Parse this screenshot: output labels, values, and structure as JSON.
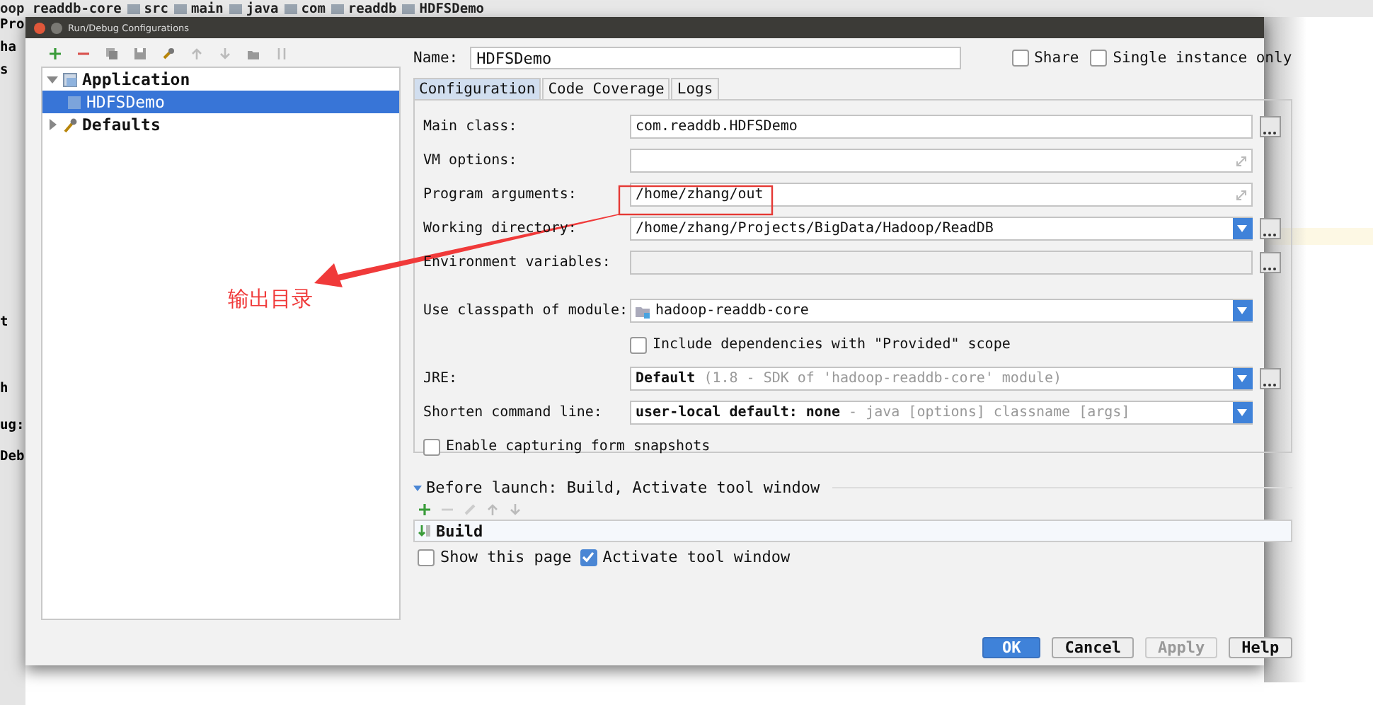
{
  "background_ide": {
    "breadcrumbs": [
      "oop readdb-core",
      "src",
      "main",
      "java",
      "com",
      "readdb",
      "HDFSDemo"
    ],
    "side_fragments": [
      "Pro",
      "ha",
      "s",
      "t",
      "h",
      "ug:",
      "Deb"
    ]
  },
  "dialog": {
    "title": "Run/Debug Configurations",
    "tree": [
      {
        "label": "Application",
        "expanded": true,
        "selected": false,
        "children": [
          {
            "label": "HDFSDemo",
            "selected": true
          }
        ]
      },
      {
        "label": "Defaults",
        "expanded": false,
        "selected": false
      }
    ],
    "name": {
      "label": "Name:",
      "value": "HDFSDemo"
    },
    "options": [
      {
        "label": "Share",
        "checked": false
      },
      {
        "label": "Single instance only",
        "checked": false
      }
    ],
    "tabs": [
      {
        "label": "Configuration",
        "selected": true
      },
      {
        "label": "Code Coverage",
        "selected": false
      },
      {
        "label": "Logs",
        "selected": false
      }
    ],
    "fields": [
      {
        "kind": "browse",
        "label": "Main class:",
        "value": "com.readdb.HDFSDemo"
      },
      {
        "kind": "expand",
        "label": "VM options:"
      },
      {
        "kind": "expand",
        "label": "Program arguments:",
        "value": "/home/zhang/out"
      },
      {
        "kind": "dropdown_browse",
        "label": "Working directory:",
        "value": "/home/zhang/Projects/BigData/Hadoop/ReadDB"
      },
      {
        "kind": "disabled_browse",
        "label": "Environment variables:"
      },
      {
        "kind": "module",
        "label": "Use classpath of module:",
        "value": "hadoop-readdb-core"
      },
      {
        "kind": "sub_checkbox",
        "label": "Include dependencies with \"Provided\" scope",
        "checked": false
      },
      {
        "kind": "dropdown_browse",
        "label": "JRE:",
        "value": "Default",
        "hint": "(1.8 - SDK of 'hadoop-readdb-core' module)"
      },
      {
        "kind": "dropdown",
        "label": "Shorten command line:",
        "value": "user-local default: none",
        "hint": "- java [options] classname [args]"
      },
      {
        "kind": "checkbox",
        "label": "Enable capturing form snapshots",
        "checked": false
      }
    ],
    "before_launch": {
      "title": "Before launch: Build, Activate tool window",
      "expanded": true,
      "tasks": [
        "Build"
      ],
      "options": [
        {
          "label": "Show this page",
          "checked": false
        },
        {
          "label": "Activate tool window",
          "checked": true
        }
      ]
    },
    "buttons": [
      {
        "label": "OK",
        "primary": true,
        "disabled": false
      },
      {
        "label": "Cancel",
        "primary": false,
        "disabled": false
      },
      {
        "label": "Apply",
        "primary": false,
        "disabled": true
      },
      {
        "label": "Help",
        "primary": false,
        "disabled": false
      }
    ]
  },
  "annotation": {
    "text": "输出目录"
  }
}
